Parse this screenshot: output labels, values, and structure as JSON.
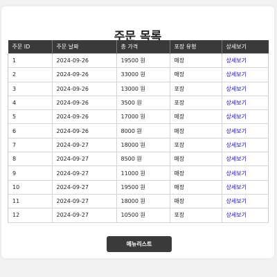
{
  "page": {
    "title": "주문 목록"
  },
  "table": {
    "headers": [
      "주문 ID",
      "주문 날짜",
      "총 가격",
      "포장 유형",
      "상세보기"
    ],
    "rows": [
      {
        "id": "1",
        "date": "2024-09-26",
        "total": "19500 원",
        "type": "매장",
        "detail": "상세보기"
      },
      {
        "id": "2",
        "date": "2024-09-26",
        "total": "33000 원",
        "type": "매장",
        "detail": "상세보기"
      },
      {
        "id": "3",
        "date": "2024-09-26",
        "total": "13000 원",
        "type": "포장",
        "detail": "상세보기"
      },
      {
        "id": "4",
        "date": "2024-09-26",
        "total": "3500 원",
        "type": "포장",
        "detail": "상세보기"
      },
      {
        "id": "5",
        "date": "2024-09-26",
        "total": "17000 원",
        "type": "매장",
        "detail": "상세보기"
      },
      {
        "id": "6",
        "date": "2024-09-26",
        "total": "8000 원",
        "type": "매장",
        "detail": "상세보기"
      },
      {
        "id": "7",
        "date": "2024-09-27",
        "total": "18000 원",
        "type": "포장",
        "detail": "상세보기"
      },
      {
        "id": "8",
        "date": "2024-09-27",
        "total": "8500 원",
        "type": "매장",
        "detail": "상세보기"
      },
      {
        "id": "9",
        "date": "2024-09-27",
        "total": "11000 원",
        "type": "매장",
        "detail": "상세보기"
      },
      {
        "id": "10",
        "date": "2024-09-27",
        "total": "19500 원",
        "type": "매장",
        "detail": "상세보기"
      },
      {
        "id": "11",
        "date": "2024-09-27",
        "total": "18000 원",
        "type": "매장",
        "detail": "상세보기"
      },
      {
        "id": "12",
        "date": "2024-09-27",
        "total": "10500 원",
        "type": "포장",
        "detail": "상세보기"
      }
    ]
  },
  "footer": {
    "menu_button_label": "메뉴리스트"
  },
  "colors": {
    "header_bg": "#3a3a3a",
    "link": "#1a0dab",
    "button_bg": "#3a3a3a"
  }
}
